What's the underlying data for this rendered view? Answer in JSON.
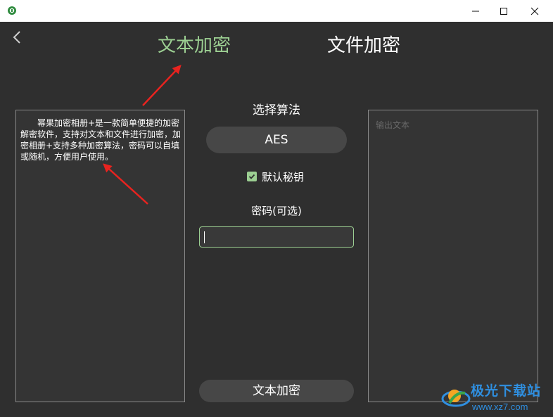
{
  "window": {
    "app_icon": "app-shield-icon",
    "controls": [
      "minimize-icon",
      "maximize-icon",
      "close-icon"
    ]
  },
  "nav": {
    "back_icon": "chevron-left-icon",
    "tabs": [
      {
        "label": "文本加密",
        "active": true
      },
      {
        "label": "文件加密",
        "active": false
      }
    ]
  },
  "input_panel": {
    "text": "幂果加密相册+是一款简单便捷的加密解密软件，支持对文本和文件进行加密，加密相册+支持多种加密算法，密码可以自填或随机，方便用户使用。"
  },
  "algorithm": {
    "label": "选择算法",
    "selected": "AES"
  },
  "default_key": {
    "label": "默认秘钥",
    "checked": true
  },
  "password": {
    "label": "密码(可选)",
    "value": ""
  },
  "output_panel": {
    "placeholder": "输出文本"
  },
  "actions": {
    "encrypt_label": "文本加密"
  },
  "watermark": {
    "title": "极光下载站",
    "url": "www.xz7.com"
  },
  "colors": {
    "accent": "#9ccf92",
    "background": "#2f2f2f",
    "panel": "#343434",
    "button": "#474747",
    "annotation_arrow": "#e8231f",
    "watermark": "#2f8fe0"
  }
}
